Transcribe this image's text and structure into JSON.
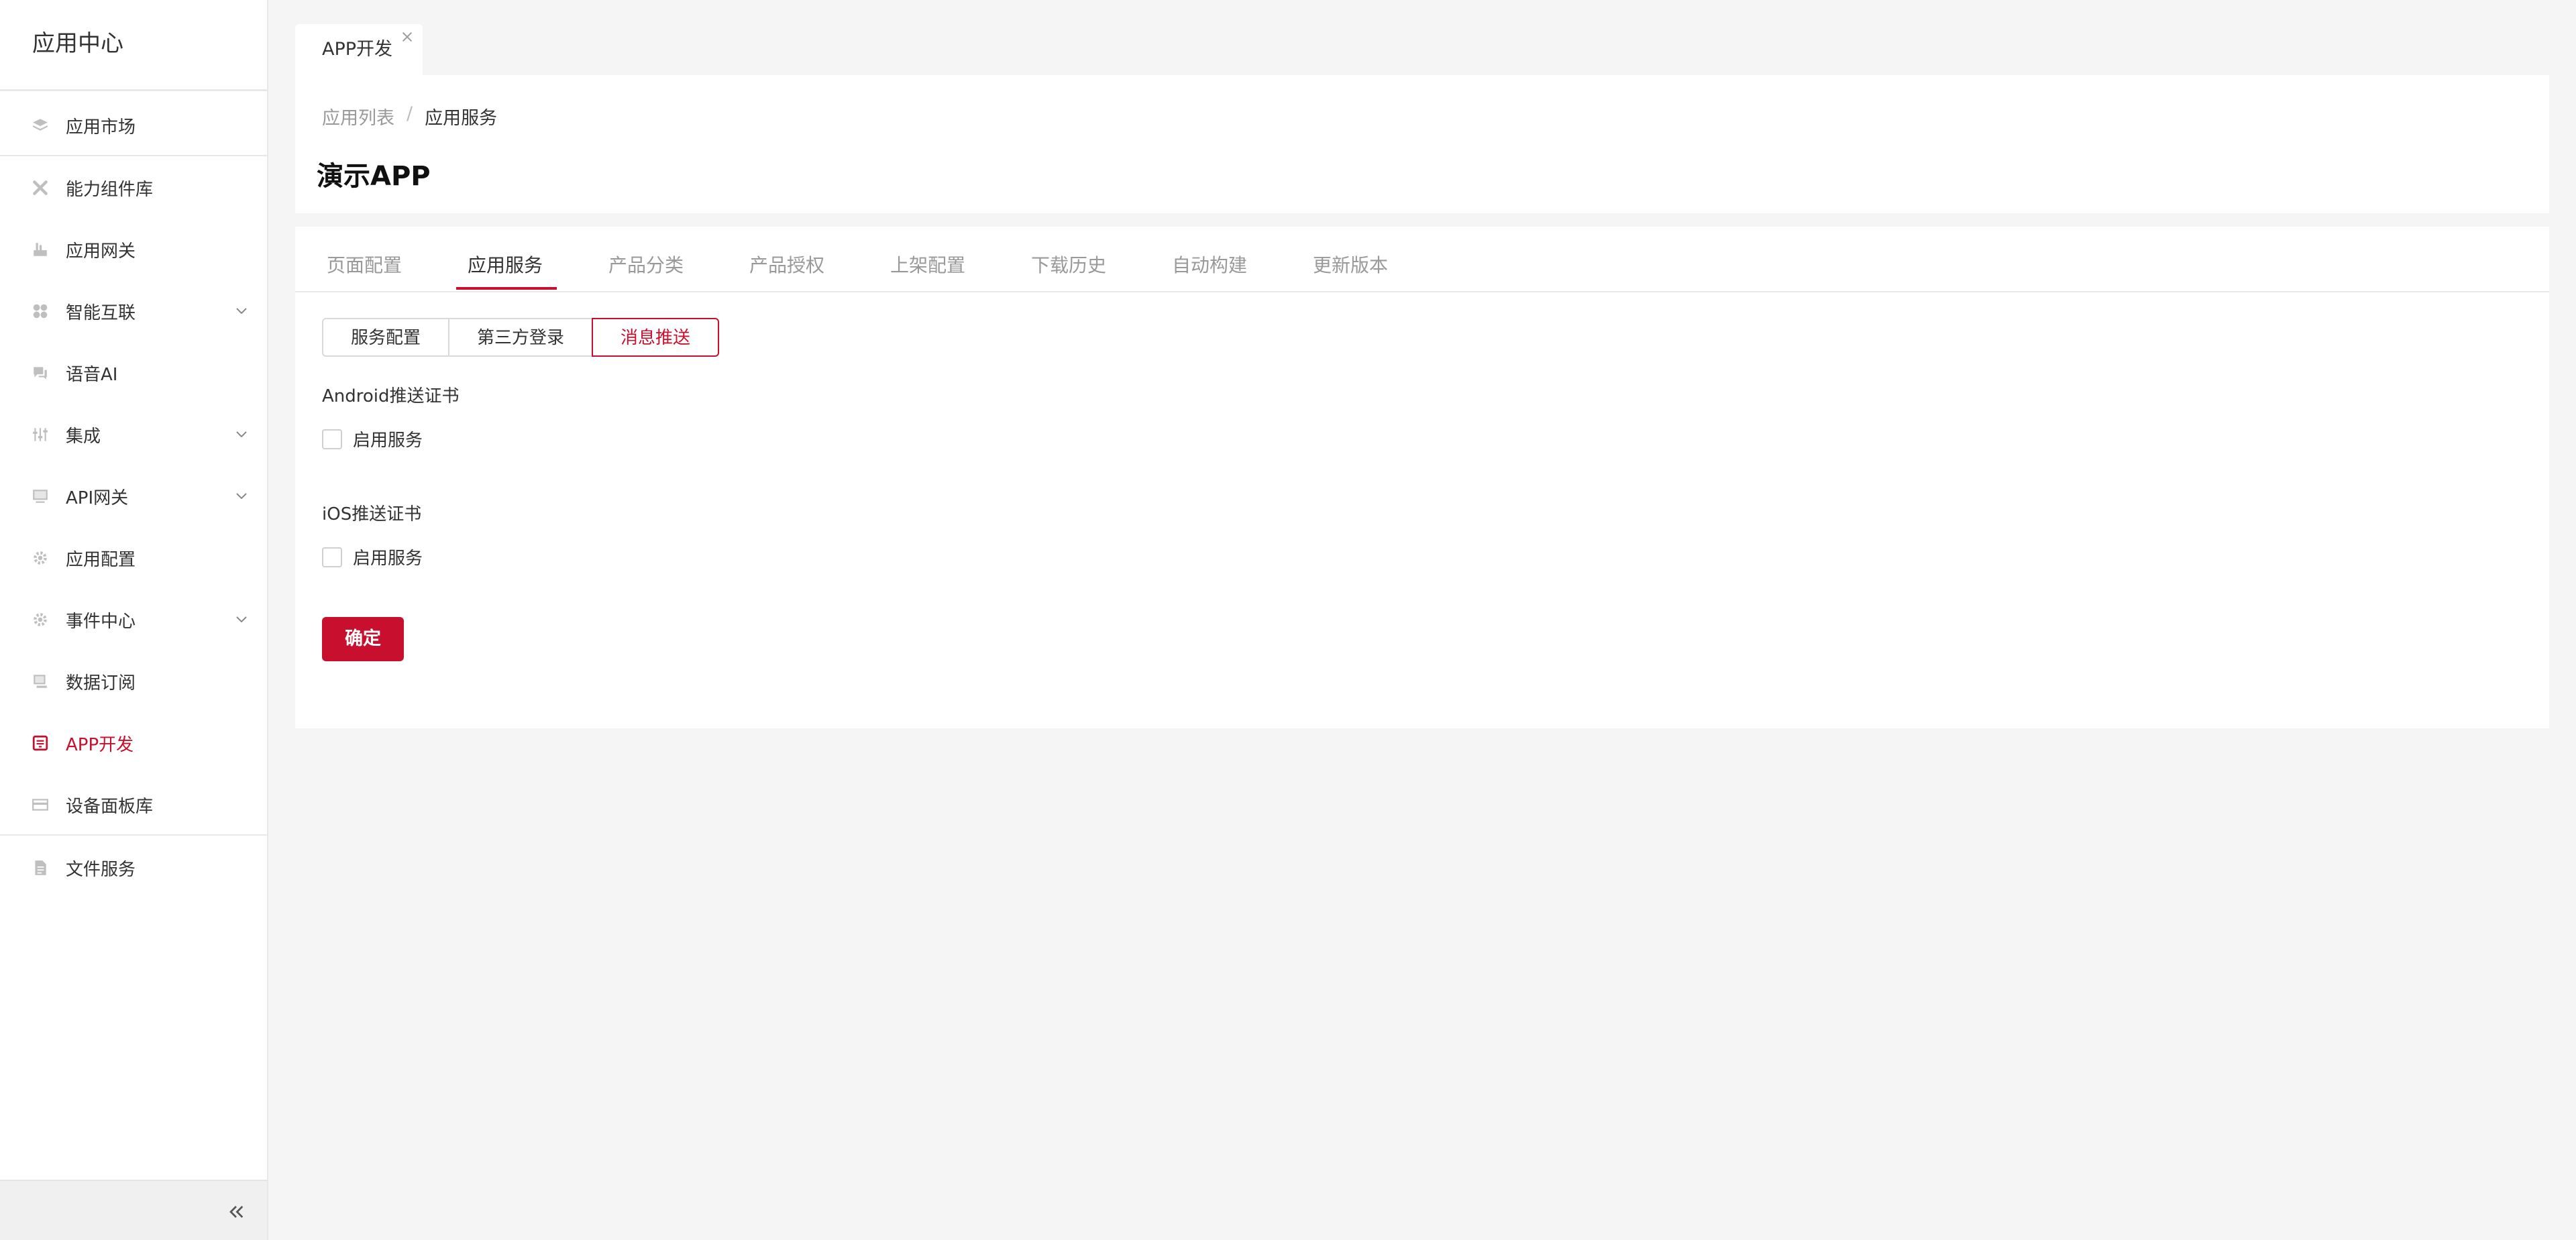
{
  "sidebar": {
    "title": "应用中心",
    "items": [
      {
        "label": "应用市场",
        "icon": "layers-icon"
      },
      {
        "label": "能力组件库",
        "icon": "tools-icon"
      },
      {
        "label": "应用网关",
        "icon": "gateway-icon"
      },
      {
        "label": "智能互联",
        "icon": "grid-icon",
        "expandable": true
      },
      {
        "label": "语音AI",
        "icon": "chat-icon"
      },
      {
        "label": "集成",
        "icon": "sliders-icon",
        "expandable": true
      },
      {
        "label": "API网关",
        "icon": "monitor-icon",
        "expandable": true
      },
      {
        "label": "应用配置",
        "icon": "gear-icon"
      },
      {
        "label": "事件中心",
        "icon": "gear-icon",
        "expandable": true
      },
      {
        "label": "数据订阅",
        "icon": "monitor-icon"
      },
      {
        "label": "APP开发",
        "icon": "app-icon",
        "active": true
      },
      {
        "label": "设备面板库",
        "icon": "panel-icon"
      },
      {
        "label": "文件服务",
        "icon": "file-icon"
      }
    ],
    "collapse_icon": "double-chevron-left-icon"
  },
  "page_tab": {
    "label": "APP开发"
  },
  "breadcrumb": {
    "parent": "应用列表",
    "separator": "/",
    "current": "应用服务"
  },
  "page_title": "演示APP",
  "tabs": [
    "页面配置",
    "应用服务",
    "产品分类",
    "产品授权",
    "上架配置",
    "下载历史",
    "自动构建",
    "更新版本"
  ],
  "active_tab": "应用服务",
  "segments": [
    "服务配置",
    "第三方登录",
    "消息推送"
  ],
  "active_segment": "消息推送",
  "android": {
    "title": "Android推送证书",
    "checkbox_label": "启用服务",
    "checked": false
  },
  "ios": {
    "title": "iOS推送证书",
    "checkbox_label": "启用服务",
    "checked": false
  },
  "confirm_label": "确定",
  "colors": {
    "accent": "#c8102e",
    "background": "#f5f5f5",
    "muted_text": "#999999"
  }
}
